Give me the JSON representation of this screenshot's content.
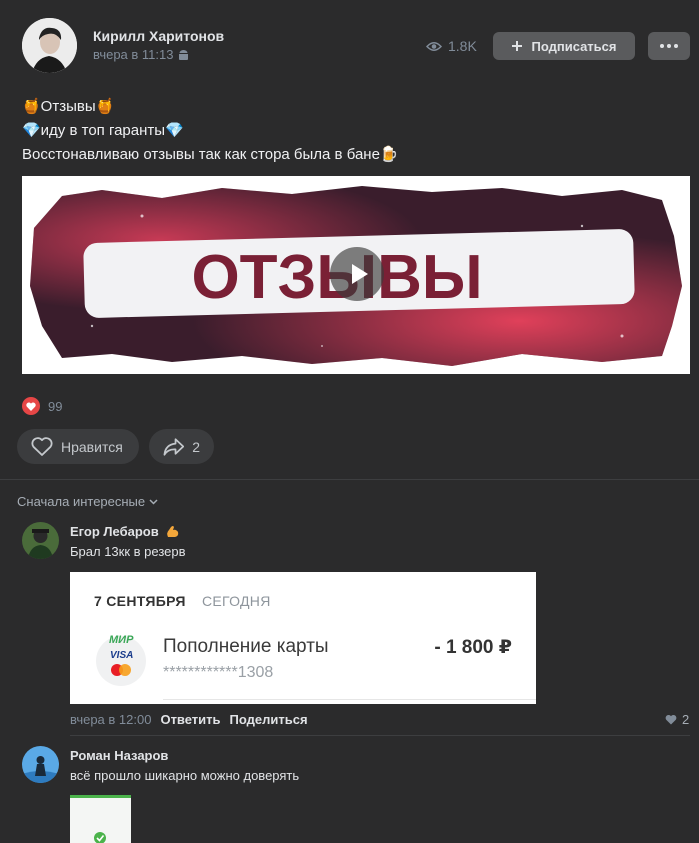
{
  "post": {
    "author": "Кирилл Харитонов",
    "time": "вчера в 11:13",
    "views": "1.8K",
    "subscribe_label": "Подписаться",
    "text_lines": [
      "🍯Отзывы🍯",
      "💎иду в топ гаранты💎",
      "Восстонавливаю отзывы так как стора была в бане🍺"
    ],
    "media_text": "ОТЗЫВЫ",
    "reactions_count": "99",
    "like_label": "Нравится",
    "share_count": "2"
  },
  "comments": {
    "sort_label": "Сначала интересные",
    "items": [
      {
        "name": "Егор Лебаров",
        "text": "Брал 13кк в резерв",
        "time": "вчера в 12:00",
        "reply_label": "Ответить",
        "share_label": "Поделиться",
        "likes": "2",
        "receipt": {
          "date": "7 СЕНТЯБРЯ",
          "today": "СЕГОДНЯ",
          "logo_mir": "МИР",
          "logo_visa": "VISA",
          "title": "Пополнение карты",
          "card": "************1308",
          "amount": "- 1 800 ₽"
        }
      },
      {
        "name": "Роман Назаров",
        "text": "всё прошло шикарно можно доверять"
      }
    ]
  },
  "colors": {
    "background": "#2b2b2c",
    "button": "#5a5b5d",
    "accent_red": "#e64646",
    "muted": "#818c99"
  }
}
